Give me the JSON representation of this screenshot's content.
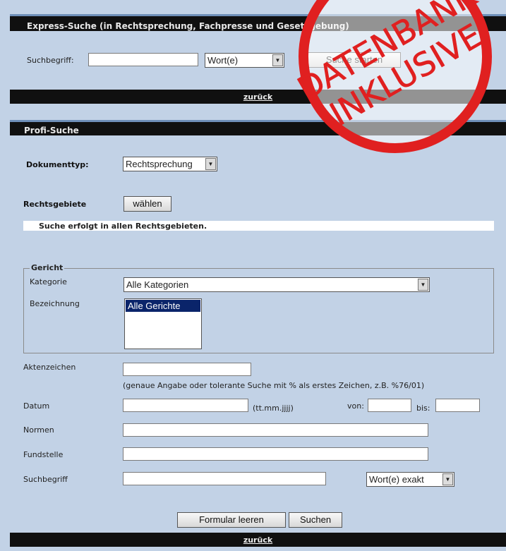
{
  "express": {
    "title": "Express-Suche (in Rechtsprechung, Fachpresse und Gesetzgebung)",
    "search_label": "Suchbegriff:",
    "search_value": "",
    "mode_value": "Wort(e)",
    "start_button": "Suche starten",
    "back_link": "zurück"
  },
  "profi": {
    "title": "Profi-Suche",
    "doc_type_label": "Dokumenttyp:",
    "doc_type_value": "Rechtsprechung",
    "areas_label": "Rechtsgebiete",
    "areas_button": "wählen",
    "notice": "Suche erfolgt in allen Rechtsgebieten.",
    "court": {
      "legend": "Gericht",
      "category_label": "Kategorie",
      "category_value": "Alle Kategorien",
      "name_label": "Bezeichnung",
      "name_options": [
        "Alle Gerichte"
      ]
    },
    "file_number_label": "Aktenzeichen",
    "file_number_hint": "(genaue Angabe oder tolerante Suche mit % als erstes Zeichen, z.B. %76/01)",
    "date_label": "Datum",
    "date_format": "(tt.mm.jjjj)",
    "from_label": "von:",
    "to_label": "bis:",
    "norms_label": "Normen",
    "source_label": "Fundstelle",
    "term_label": "Suchbegriff",
    "term_mode_value": "Wort(e) exakt",
    "clear_button": "Formular leeren",
    "search_button": "Suchen",
    "back_link": "zurück"
  },
  "stamp": {
    "line1": "DATENBANK",
    "line2": "INKLUSIVE",
    "color": "#e02020"
  }
}
